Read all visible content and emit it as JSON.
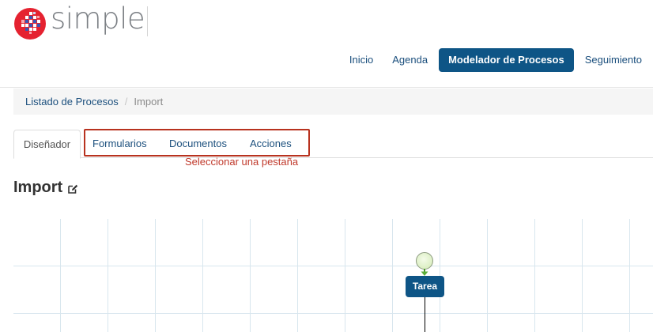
{
  "brand": {
    "name": "simple",
    "colors": {
      "red": "#e52230",
      "primary": "#0e5586",
      "link": "#1b4f7d",
      "annotation": "#c0392b"
    }
  },
  "nav": {
    "items": [
      {
        "label": "Inicio"
      },
      {
        "label": "Agenda"
      },
      {
        "label": "Modelador de Procesos",
        "active": true
      },
      {
        "label": "Seguimiento"
      }
    ]
  },
  "breadcrumb": {
    "parent": "Listado de Procesos",
    "separator": "/",
    "current": "Import"
  },
  "tabs": {
    "items": [
      {
        "label": "Diseñador",
        "active": true
      },
      {
        "label": "Formularios"
      },
      {
        "label": "Documentos"
      },
      {
        "label": "Acciones"
      }
    ],
    "annotation": "Seleccionar una pestaña"
  },
  "page": {
    "title": "Import",
    "edit_icon": "edit-icon"
  },
  "diagram": {
    "start_event_icon": "start-event-circle",
    "task_label": "Tarea"
  }
}
